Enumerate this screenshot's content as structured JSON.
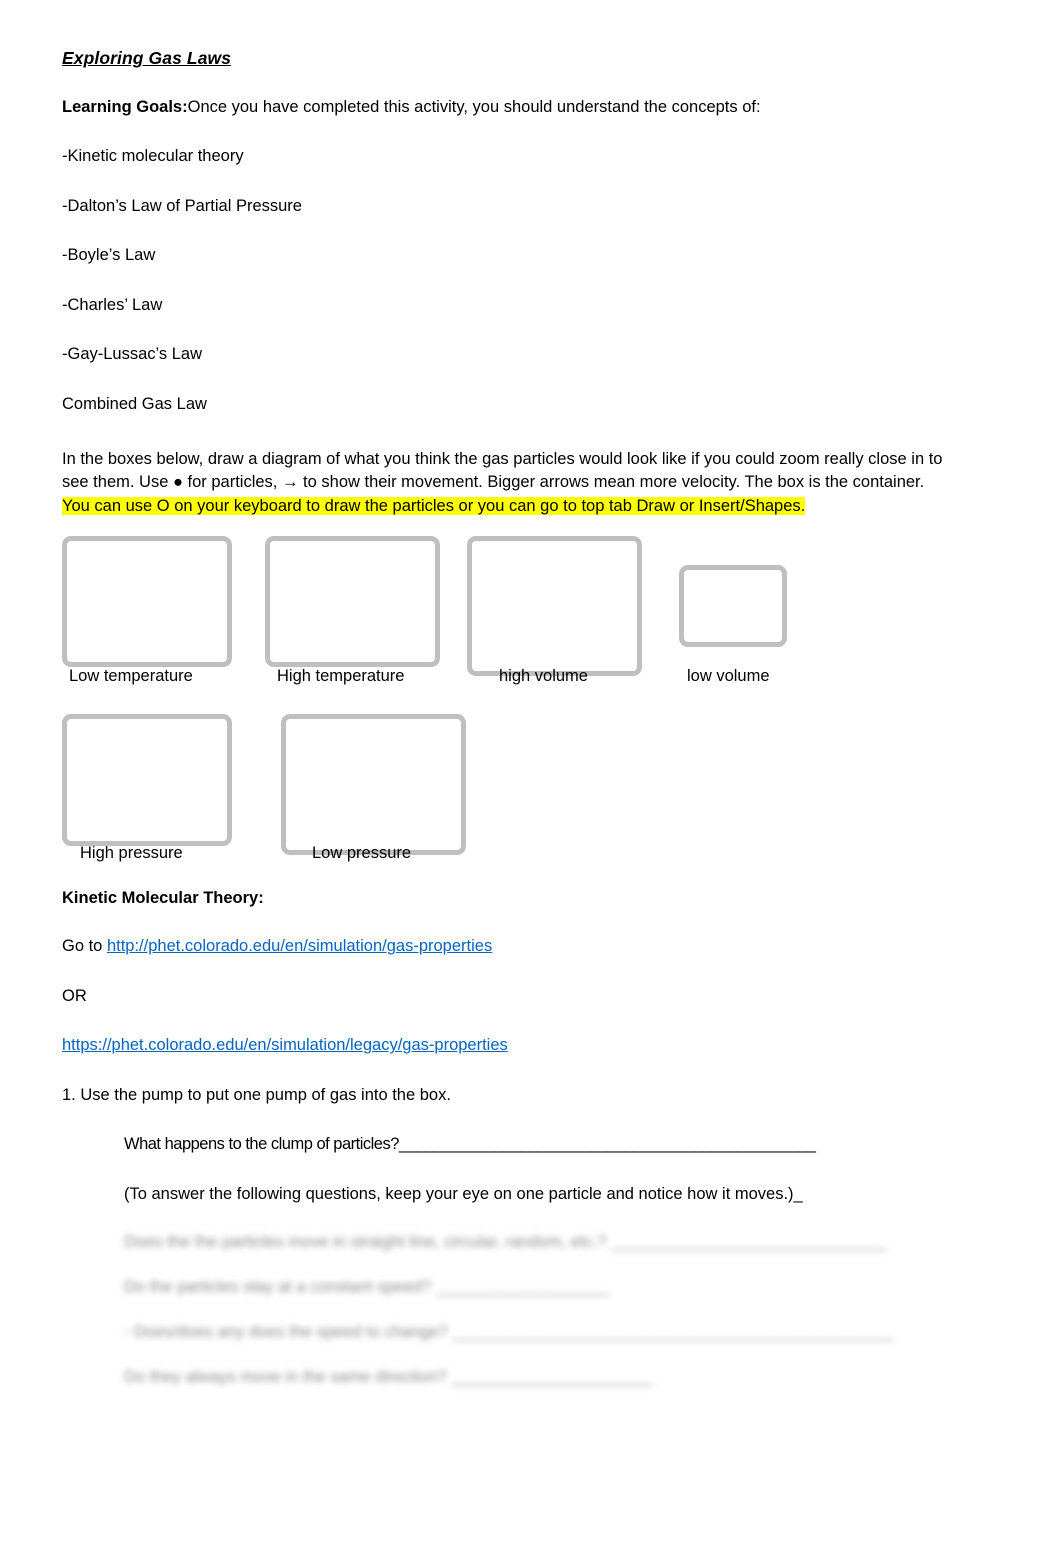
{
  "document": {
    "title": "Exploring Gas Laws",
    "learning_goals_label": "Learning Goals:",
    "learning_goals_intro": "Once you have completed this activity, you should understand the concepts of:",
    "goals": [
      "-Kinetic molecular theory",
      "-Dalton’s Law of Partial Pressure",
      "-Boyle’s Law",
      "-Charles’ Law",
      "-Gay-Lussac’s Law",
      "Combined Gas Law"
    ],
    "instructions": {
      "line1": "In the boxes below, draw a diagram of what you think the gas particles would look like if you could zoom really close in to",
      "line2": "see them. Use ● for particles, → to show their movement.  Bigger arrows mean more velocity. The box is the container.",
      "highlighted": "You can use O on your keyboard to draw the particles or you can go to top tab Draw or Insert/Shapes."
    },
    "boxes_row1": [
      {
        "label": "Low temperature"
      },
      {
        "label": "High temperature"
      },
      {
        "label": "high volume"
      },
      {
        "label": "low volume"
      }
    ],
    "boxes_row2": [
      {
        "label": "High pressure"
      },
      {
        "label": "Low pressure"
      }
    ],
    "kmt_heading": "Kinetic Molecular Theory:",
    "goto_label": "Go to ",
    "link1": "http://phet.colorado.edu/en/simulation/gas-properties",
    "or_label": "OR",
    "link2": "https://phet.colorado.edu/en/simulation/legacy/gas-properties",
    "step1": "1. Use the pump to put one pump of gas into the box.",
    "question1": "What happens to the clump of particles?________________________________________________",
    "note1": "(To answer the following questions, keep your eye on one particle and notice how it moves.)_",
    "blurred": [
      "Does the the particles move in straight line, circular, random, etc.? ______________________________",
      "Do the particles stay at a constant speed? ___________________",
      "- Does/does any does the speed to change? ________________________________________________",
      "Do they always move in the same direction? ______________________"
    ]
  },
  "colors": {
    "box_border": "#bfbfbf",
    "link": "#0563c1",
    "highlight": "#ffff00"
  }
}
